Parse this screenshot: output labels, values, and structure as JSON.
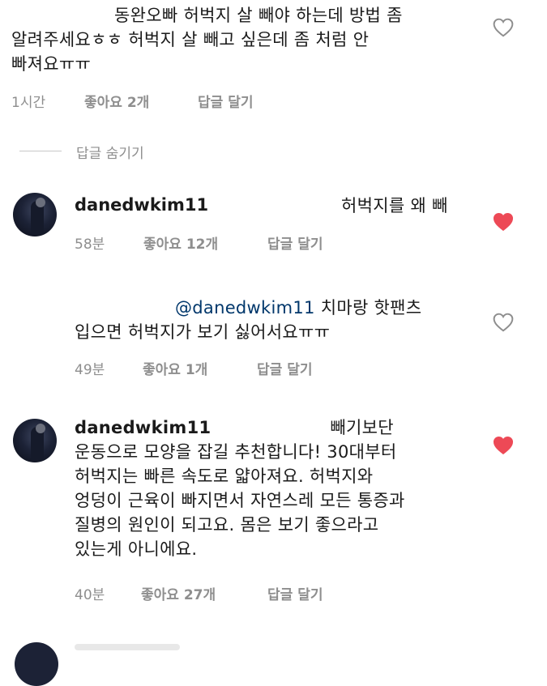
{
  "comments": [
    {
      "text_lines": [
        "동완오빠 허벅지 살 빼야 하는데 방법 좀",
        "알려주세요ㅎㅎ 허벅지 살 빼고 싶은데 좀 처럼 안",
        "빠져요ㅠㅠ"
      ],
      "time": "1시간",
      "likes": "좋아요 2개",
      "reply": "답글 달기",
      "liked": false
    },
    {
      "hide_replies": "답글 숨기기"
    },
    {
      "username": "danedwkim11",
      "text_first": "허벅지를 왜 빼",
      "time": "58분",
      "likes": "좋아요 12개",
      "reply": "답글 달기",
      "liked": true
    },
    {
      "mention": "@danedwkim11",
      "text_first": "치마랑 핫팬츠",
      "text_lines": [
        "입으면 허벅지가 보기 싫어서요ㅠㅠ"
      ],
      "time": "49분",
      "likes": "좋아요 1개",
      "reply": "답글 달기",
      "liked": false
    },
    {
      "username": "danedwkim11",
      "text_first": "빼기보단",
      "text_lines": [
        "운동으로 모양을 잡길 추천합니다! 30대부터",
        "허벅지는 빠른 속도로 얇아져요. 허벅지와",
        "엉덩이 근육이 빠지면서 자연스레 모든 통증과",
        "질병의 원인이 되고요. 몸은 보기 좋으라고",
        "있는게 아니에요."
      ],
      "time": "40분",
      "likes": "좋아요 27개",
      "reply": "답글 달기",
      "liked": true
    }
  ],
  "colors": {
    "heart_liked": "#ed4956",
    "heart_outline": "#8e8e8e",
    "meta": "#8e8e8e",
    "text": "#1a1a1a"
  }
}
